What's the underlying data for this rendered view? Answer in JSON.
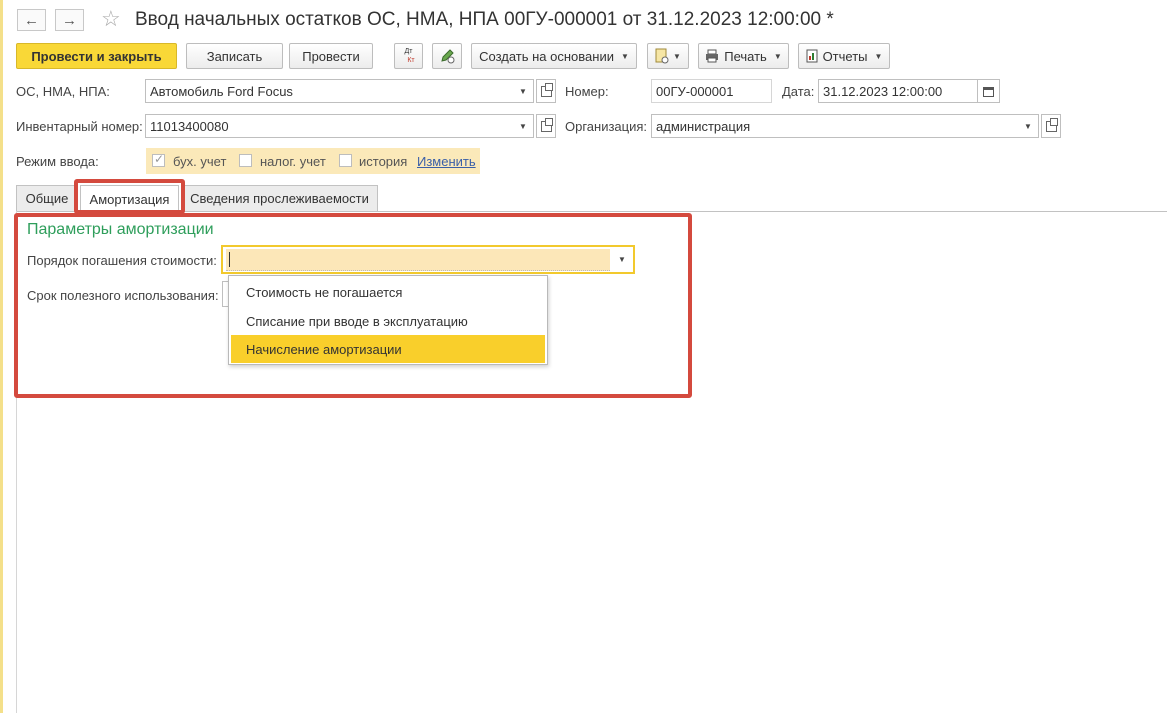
{
  "window": {
    "title": "Ввод начальных остатков ОС, НМА, НПА 00ГУ-000001 от 31.12.2023 12:00:00 *",
    "back_icon": "←",
    "forward_icon": "→",
    "star_icon": "☆"
  },
  "toolbar": {
    "post_close": "Провести и закрыть",
    "save": "Записать",
    "post": "Провести",
    "dt_kt_top": "Дт",
    "dt_kt_bottom": "Кт",
    "create_basis": "Создать на основании",
    "print": "Печать",
    "reports": "Отчеты"
  },
  "form": {
    "asset_label": "ОС, НМА, НПА:",
    "asset_value": "Автомобиль Ford Focus",
    "number_label": "Номер:",
    "number_value": "00ГУ-000001",
    "date_label": "Дата:",
    "date_value": "31.12.2023 12:00:00",
    "inventory_label": "Инвентарный номер:",
    "inventory_value": "11013400080",
    "org_label": "Организация:",
    "org_value": "администрация",
    "mode_label": "Режим ввода:",
    "mode_options": [
      {
        "label": "бух. учет",
        "checked": true
      },
      {
        "label": "налог. учет",
        "checked": false
      },
      {
        "label": "история",
        "checked": false
      }
    ],
    "change_link": "Изменить"
  },
  "tabs": [
    {
      "label": "Общие",
      "active": false
    },
    {
      "label": "Амортизация",
      "active": true
    },
    {
      "label": "Сведения прослеживаемости",
      "active": false
    }
  ],
  "amortization": {
    "section_title": "Параметры амортизации",
    "order_label": "Порядок погашения стоимости:",
    "order_value": "",
    "term_label": "Срок полезного использования:",
    "dropdown_options": [
      {
        "label": "Стоимость не погашается",
        "selected": false
      },
      {
        "label": "Списание при вводе в эксплуатацию",
        "selected": false
      },
      {
        "label": "Начисление амортизации",
        "selected": true
      }
    ]
  },
  "colors": {
    "accent_yellow": "#f9d837",
    "highlight_red": "#d44a3e",
    "section_green": "#2e9e5b",
    "link_blue": "#3a5fa8"
  }
}
